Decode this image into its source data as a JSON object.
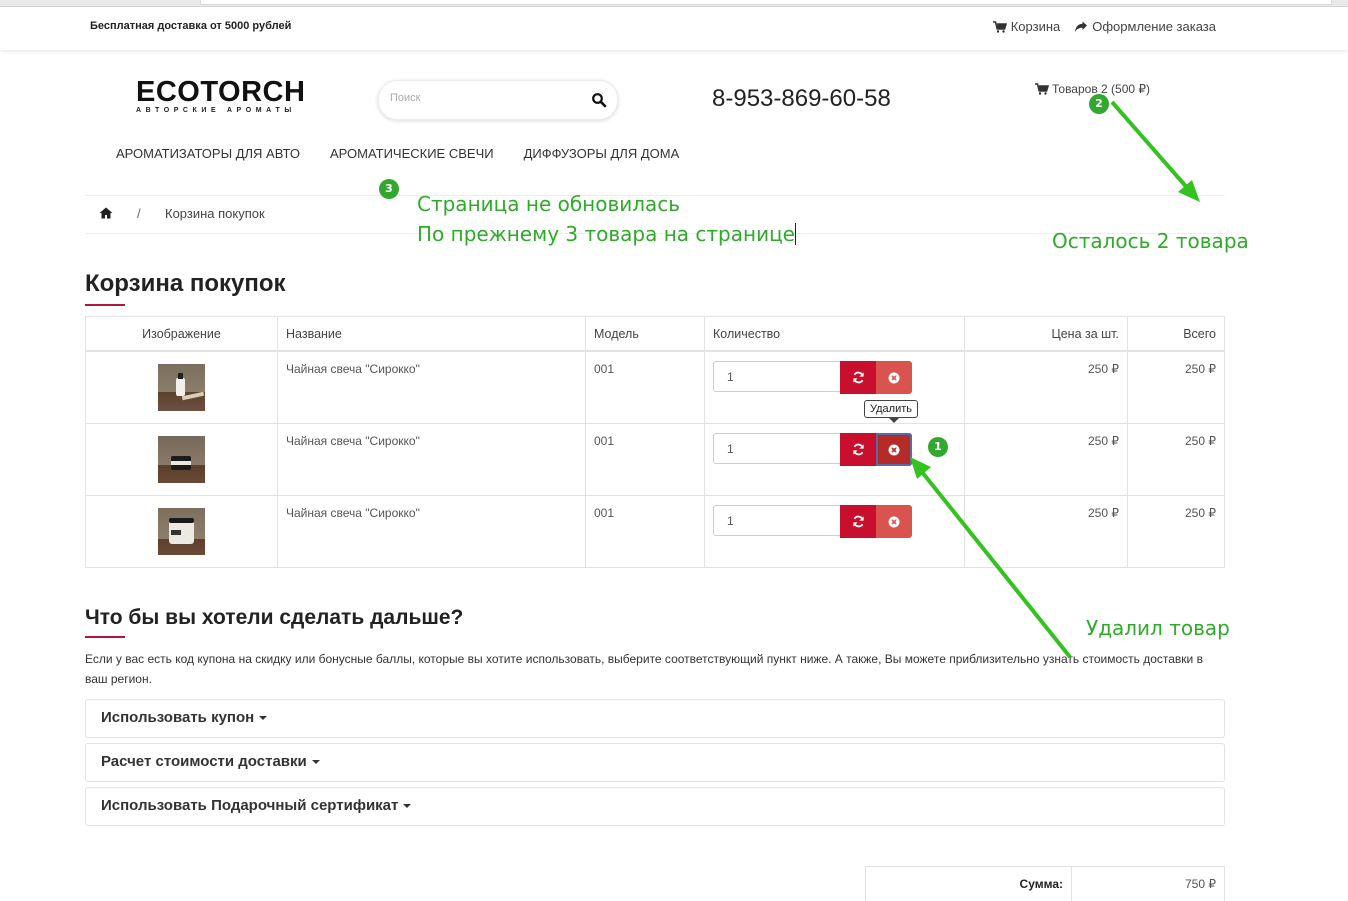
{
  "topbar": {
    "shipping": "Бесплатная доставка от 5000 рублей",
    "cart_link": "Корзина",
    "checkout_link": "Оформление заказа"
  },
  "header": {
    "logo_main": "ECOTORCH",
    "logo_sub": "АВТОРСКИЕ АРОМАТЫ",
    "search_placeholder": "Поиск",
    "phone": "8-953-869-60-58",
    "cart_summary": "Товаров 2 (500 ₽)"
  },
  "menu": [
    "АРОМАТИЗАТОРЫ ДЛЯ АВТО",
    "АРОМАТИЧЕСКИЕ СВЕЧИ",
    "ДИФФУЗОРЫ ДЛЯ ДОМА"
  ],
  "breadcrumb": {
    "sep": "/",
    "current": "Корзина покупок"
  },
  "page_title": "Корзина покупок",
  "table": {
    "headers": [
      "Изображение",
      "Название",
      "Модель",
      "Количество",
      "Цена за шт.",
      "Всего"
    ],
    "rows": [
      {
        "name": "Чайная свеча \"Сирокко\"",
        "model": "001",
        "qty": "1",
        "price": "250 ₽",
        "total": "250 ₽"
      },
      {
        "name": "Чайная свеча \"Сирокко\"",
        "model": "001",
        "qty": "1",
        "price": "250 ₽",
        "total": "250 ₽"
      },
      {
        "name": "Чайная свеча \"Сирокко\"",
        "model": "001",
        "qty": "1",
        "price": "250 ₽",
        "total": "250 ₽"
      }
    ]
  },
  "tooltip": "Удалить",
  "next": {
    "title": "Что бы вы хотели сделать дальше?",
    "intro": "Если у вас есть код купона на скидку или бонусные баллы, которые вы хотите использовать, выберите соответствующий пункт ниже. А также, Вы можете приблизительно узнать стоимость доставки в ваш регион.",
    "panels": [
      "Использовать купон",
      "Расчет стоимости доставки",
      "Использовать Подарочный сертификат"
    ]
  },
  "totals": {
    "sum_label": "Сумма:",
    "sum_value": "750 ₽"
  },
  "annotations": {
    "note_line1": "Страница не обновилась",
    "note_line2": "По прежнему 3 товара на странице",
    "remaining": "Осталось 2 товара",
    "deleted": "Удалил товар",
    "badge1": "1",
    "badge2": "2",
    "badge3": "3",
    "color": "#2faa2a"
  },
  "icons": {
    "cart": "cart-icon",
    "checkout": "share-arrow-icon",
    "search": "search-icon",
    "home": "home-icon",
    "refresh": "refresh-icon",
    "remove": "times-circle-icon"
  }
}
